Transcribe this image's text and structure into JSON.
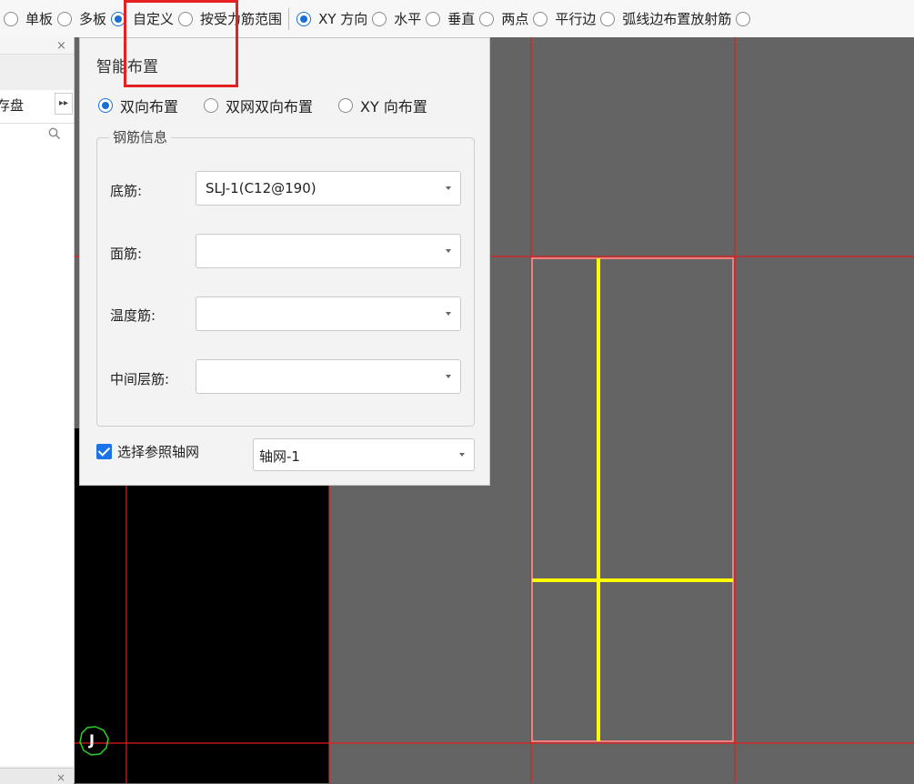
{
  "toolbar": {
    "radios": [
      {
        "label": "单板",
        "checked": false
      },
      {
        "label": "多板",
        "checked": false
      },
      {
        "label": "自定义",
        "checked": true
      },
      {
        "label": "按受力筋范围",
        "checked": false
      }
    ],
    "direction_radios": [
      {
        "label": "XY 方向",
        "checked": true
      },
      {
        "label": "水平",
        "checked": false
      },
      {
        "label": "垂直",
        "checked": false
      },
      {
        "label": "两点",
        "checked": false
      },
      {
        "label": "平行边",
        "checked": false
      },
      {
        "label": "弧线边布置放射筋",
        "checked": false
      }
    ]
  },
  "left_panel": {
    "label": "存盘",
    "close_glyph": "×",
    "expand_glyph": "▸▸",
    "search_icon": "magnifier"
  },
  "dialog": {
    "title": "智能布置",
    "mode_radios": [
      {
        "label": "双向布置",
        "checked": true
      },
      {
        "label": "双网双向布置",
        "checked": false
      },
      {
        "label": "XY 向布置",
        "checked": false
      }
    ],
    "group_title": "钢筋信息",
    "fields": [
      {
        "label": "底筋:",
        "value": "SLJ-1(C12@190)"
      },
      {
        "label": "面筋:",
        "value": ""
      },
      {
        "label": "温度筋:",
        "value": ""
      },
      {
        "label": "中间层筋:",
        "value": ""
      }
    ],
    "reference_grid": {
      "label": "选择参照轴网",
      "checked": true,
      "value": "轴网-1"
    }
  },
  "canvas": {
    "axis_marker": "J",
    "colors": {
      "background": "#646464",
      "black_region": "#000000",
      "grid_line": "#e01e1e",
      "slab_outline": "#f08080",
      "rebar": "#ffff00",
      "axis_circle": "#2bd12b"
    }
  }
}
